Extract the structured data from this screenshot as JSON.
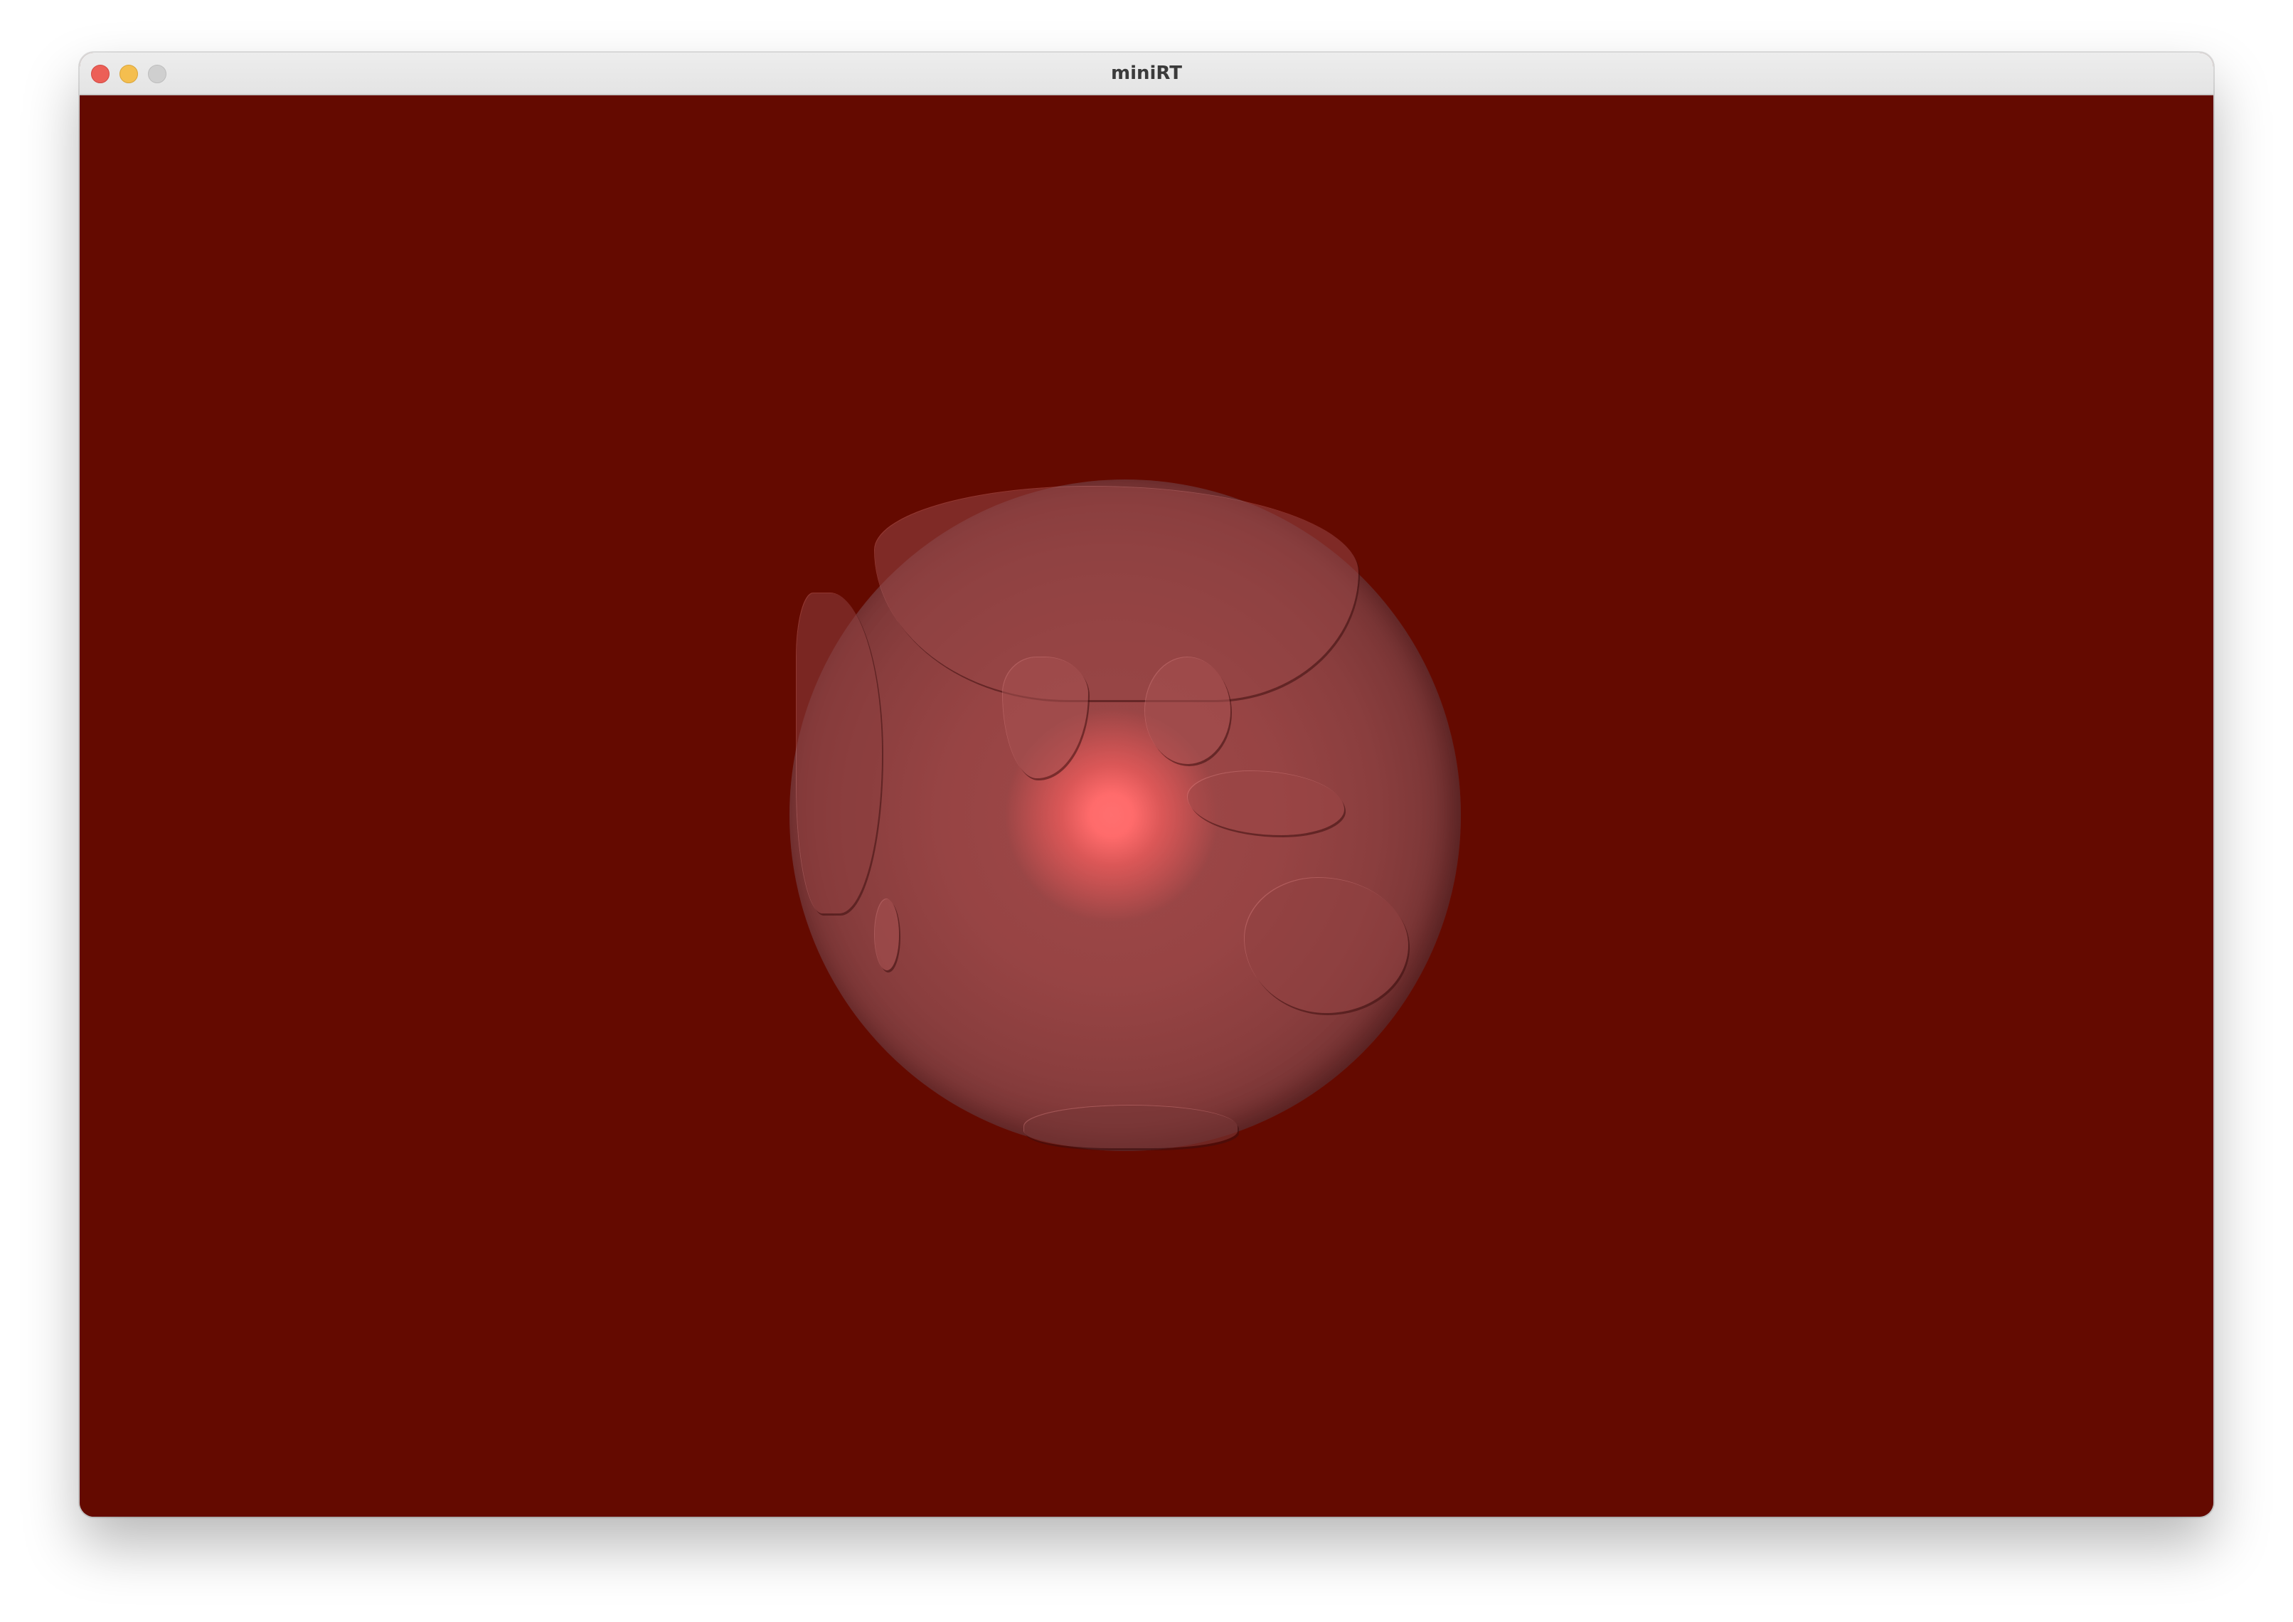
{
  "window": {
    "title": "miniRT"
  },
  "traffic_lights": {
    "close": "close-button",
    "minimize": "minimize-button",
    "zoom": "zoom-button"
  },
  "render": {
    "background_color": "#640a00",
    "sphere_base_color": "#974444",
    "highlight_color": "#ff6b6b",
    "texture": "earth-bump-map"
  },
  "colors": {
    "close": "#ec5f57",
    "minimize": "#f4be4f",
    "zoom": "#cfcfcf"
  }
}
